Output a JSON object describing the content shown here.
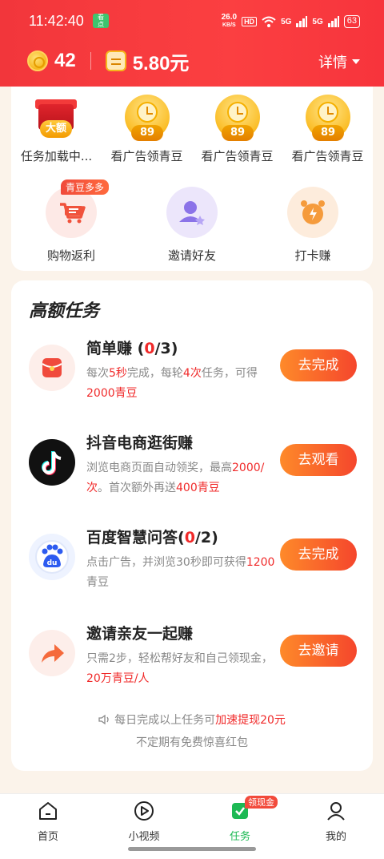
{
  "status_bar": {
    "time": "11:42:40",
    "speed": "26.0",
    "speed_unit": "KB/S",
    "hd": "HD",
    "net1": "5G",
    "net2": "5G",
    "battery": "63"
  },
  "header": {
    "coins": "42",
    "cash": "5.80元",
    "details_label": "详情"
  },
  "top_icons": [
    {
      "label": "任务加载中...",
      "tag": "大额"
    },
    {
      "label": "看广告领青豆",
      "tag": "89"
    },
    {
      "label": "看广告领青豆",
      "tag": "89"
    },
    {
      "label": "看广告领青豆",
      "tag": "89"
    }
  ],
  "second_icons": [
    {
      "label": "购物返利",
      "badge": "青豆多多"
    },
    {
      "label": "邀请好友"
    },
    {
      "label": "打卡赚"
    }
  ],
  "section": {
    "title": "高额任务"
  },
  "tasks": [
    {
      "name_prefix": "简单赚 (",
      "name_count": "0",
      "name_suffix": "/3)",
      "desc_1": "每次",
      "desc_r1": "5秒",
      "desc_2": "完成，每轮",
      "desc_r2": "4次",
      "desc_3": "任务，可得",
      "desc_r3": "2000青豆",
      "button": "去完成"
    },
    {
      "name": "抖音电商逛街赚",
      "desc_1": "浏览电商页面自动领奖，最高",
      "desc_r1": "2000/次",
      "desc_2": "。首次额外再送",
      "desc_r2": "400青豆",
      "button": "去观看"
    },
    {
      "name_prefix": "百度智慧问答(",
      "name_count": "0",
      "name_suffix": "/2)",
      "desc_1": "点击广告，并浏览30秒即可获得",
      "desc_r1": "1200",
      "desc_2": "青豆",
      "button": "去完成"
    },
    {
      "name": "邀请亲友一起赚",
      "desc_1": "只需2步，轻松帮好友和自己领现金，",
      "desc_r1": "20万青豆/人",
      "button": "去邀请"
    }
  ],
  "notes": {
    "line1_prefix": "每日完成以上任务可",
    "line1_highlight": "加速提现20元",
    "line2": "不定期有免费惊喜红包"
  },
  "bottom_nav": [
    {
      "label": "首页",
      "icon": "home-icon"
    },
    {
      "label": "小视频",
      "icon": "play-icon"
    },
    {
      "label": "任务",
      "icon": "task-icon",
      "badge": "领现金",
      "active": true
    },
    {
      "label": "我的",
      "icon": "profile-icon"
    }
  ],
  "colors": {
    "header_red": "#f7343c",
    "accent_orange": "#fe8a2a",
    "accent_red": "#f02a2a",
    "nav_active": "#1db954"
  }
}
